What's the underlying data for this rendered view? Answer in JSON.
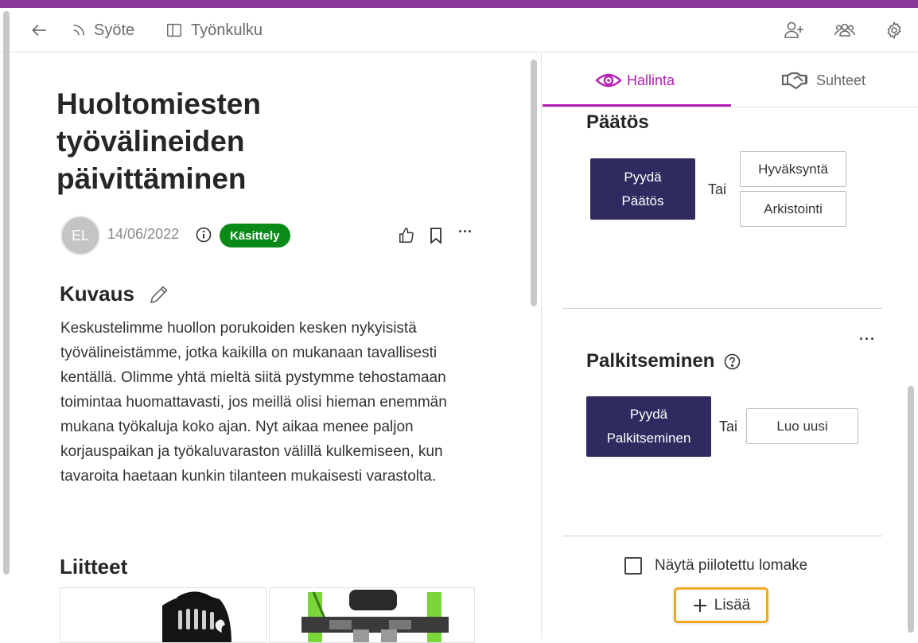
{
  "header": {
    "back_label": "",
    "feed_label": "Syöte",
    "workflow_label": "Työnkulku"
  },
  "post": {
    "title": "Huoltomiesten työvälineiden päivittäminen",
    "avatar_initials": "EL",
    "date": "14/06/2022",
    "status": "Käsittely",
    "status_color": "#0a8a17"
  },
  "description": {
    "heading": "Kuvaus",
    "text": "Keskustelimme huollon porukoiden kesken nykyisistä työvälineistämme, jotka kaikilla on mukanaan tavallisesti kentällä. Olimme yhtä mieltä siitä pystymme tehostamaan toimintaa huomattavasti, jos meillä olisi hieman enemmän mukana työkaluja koko ajan. Nyt aikaa menee paljon korjauspaikan ja työkaluvaraston välillä kulkemiseen, kun tavaroita haetaan kunkin tilanteen mukaisesti varastolta."
  },
  "attachments": {
    "heading": "Liitteet"
  },
  "tabs": {
    "manage": "Hallinta",
    "relations": "Suhteet",
    "active_color": "#b51fb5"
  },
  "decision": {
    "heading": "Päätös",
    "request_line1": "Pyydä",
    "request_line2": "Päätös",
    "or": "Tai",
    "approve": "Hyväksyntä",
    "archive": "Arkistointi"
  },
  "reward": {
    "heading": "Palkitseminen",
    "request_line1": "Pyydä",
    "request_line2": "Palkitseminen",
    "or": "Tai",
    "create_new": "Luo uusi",
    "more": "···"
  },
  "footer": {
    "show_hidden_label": "Näytä piilotettu lomake",
    "add_label": "Lisää",
    "add_border_color": "#f0a81e"
  },
  "colors": {
    "accent_bar": "#8a3a9c",
    "primary_button": "#2f2b61"
  }
}
